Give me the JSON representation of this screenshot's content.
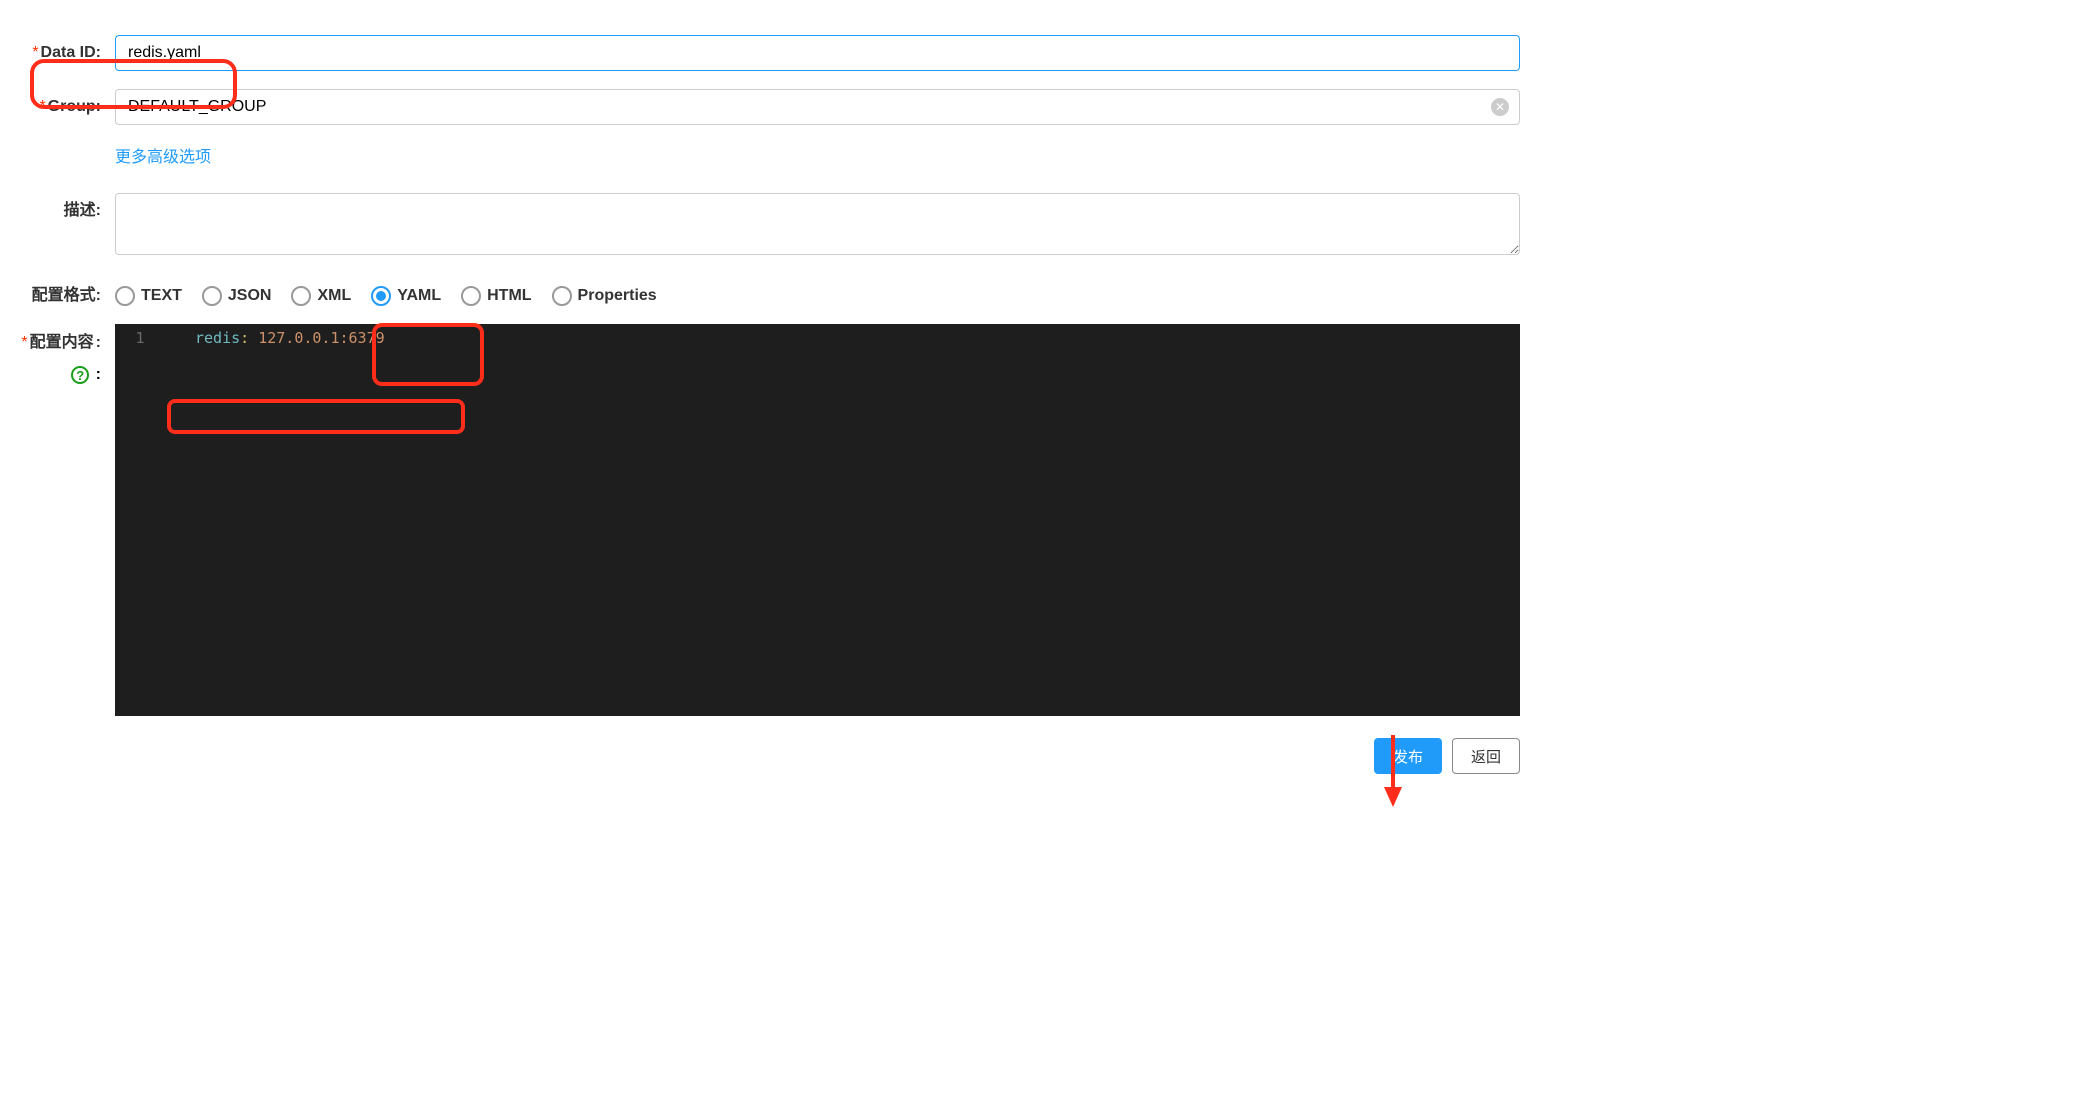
{
  "labels": {
    "data_id": "Data ID:",
    "group": "Group:",
    "desc": "描述:",
    "config_format": "配置格式:",
    "config_content": "配置内容"
  },
  "form": {
    "data_id_value": "redis.yaml",
    "group_value": "DEFAULT_GROUP",
    "advanced_link": "更多高级选项",
    "desc_value": ""
  },
  "format_options": {
    "text": "TEXT",
    "json": "JSON",
    "xml": "XML",
    "yaml": "YAML",
    "html": "HTML",
    "properties": "Properties",
    "selected": "yaml"
  },
  "code": {
    "line": "1",
    "key": "redis",
    "sep": ": ",
    "value": "127.0.0.1:6379"
  },
  "buttons": {
    "publish": "发布",
    "back": "返回"
  }
}
